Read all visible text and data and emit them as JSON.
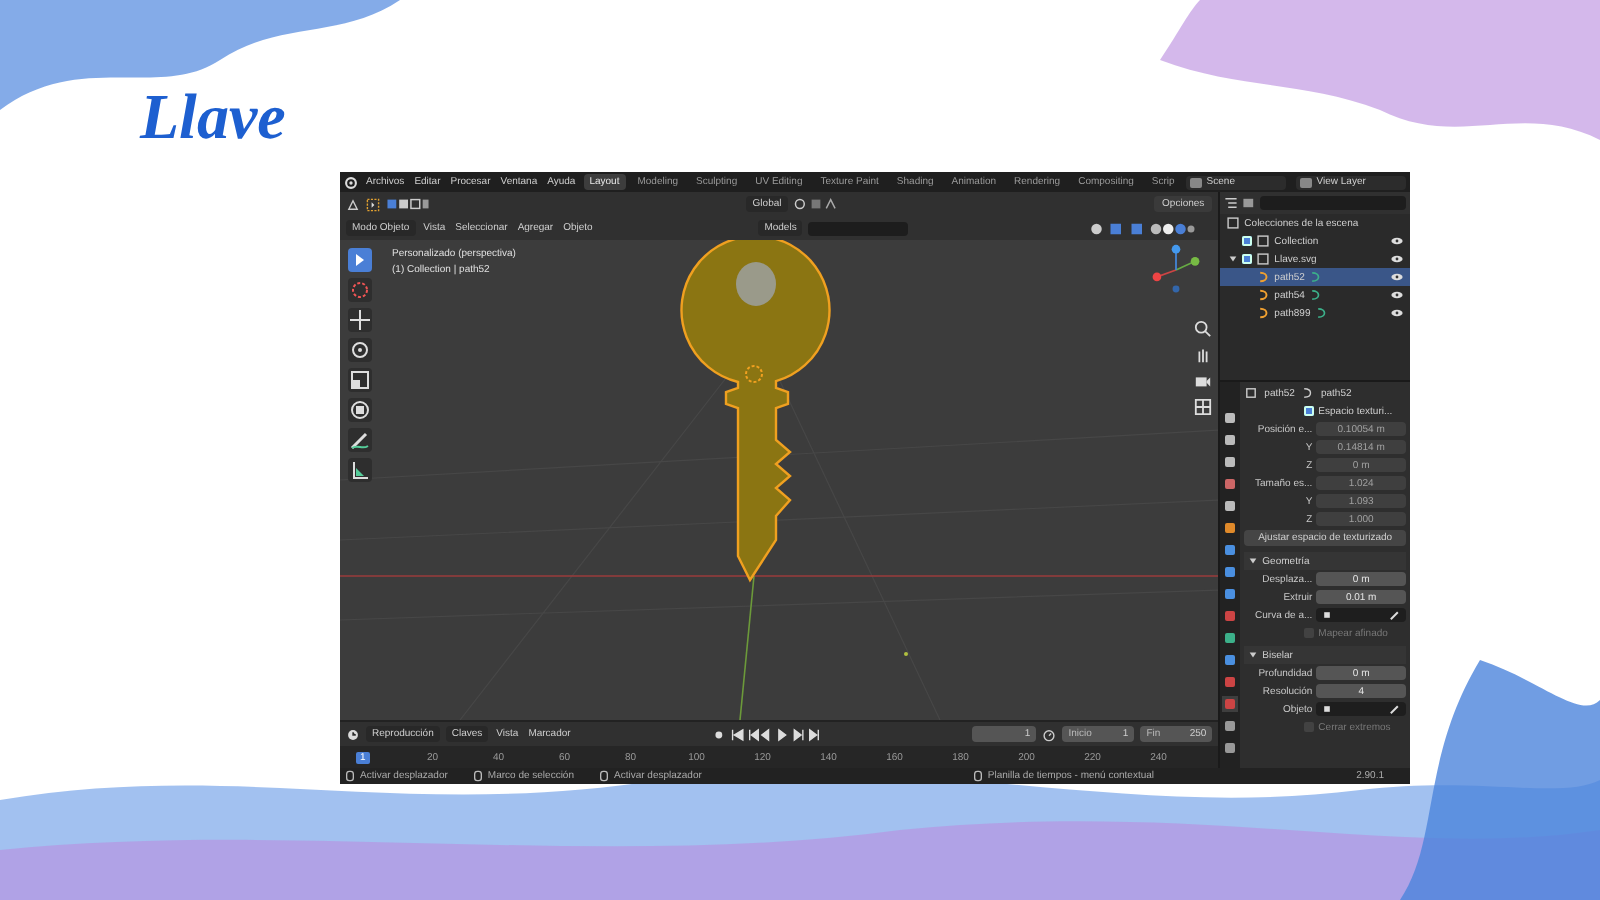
{
  "slide_title": "Llave",
  "menu": [
    "Archivos",
    "Editar",
    "Procesar",
    "Ventana",
    "Ayuda"
  ],
  "workspaces": [
    {
      "label": "Layout",
      "selected": true
    },
    {
      "label": "Modeling",
      "selected": false
    },
    {
      "label": "Sculpting",
      "selected": false
    },
    {
      "label": "UV Editing",
      "selected": false
    },
    {
      "label": "Texture Paint",
      "selected": false
    },
    {
      "label": "Shading",
      "selected": false
    },
    {
      "label": "Animation",
      "selected": false
    },
    {
      "label": "Rendering",
      "selected": false
    },
    {
      "label": "Compositing",
      "selected": false
    },
    {
      "label": "Scrip",
      "selected": false
    }
  ],
  "scene": "Scene",
  "view_layer": "View Layer",
  "viewport": {
    "orientation": "Global",
    "options": "Opciones",
    "mode": "Modo Objeto",
    "menus": [
      "Vista",
      "Seleccionar",
      "Agregar",
      "Objeto"
    ],
    "collection_filter": "Models",
    "view_name": "Personalizado (perspectiva)",
    "collection_path": "(1) Collection | path52"
  },
  "outliner": {
    "root": "Colecciones de la escena",
    "items": [
      {
        "label": "Collection",
        "checked": true
      },
      {
        "label": "Llave.svg",
        "checked": true,
        "children": [
          {
            "label": "path52",
            "selected": true
          },
          {
            "label": "path54",
            "selected": false
          },
          {
            "label": "path899",
            "selected": false
          }
        ]
      }
    ]
  },
  "properties": {
    "object": "path52",
    "data": "path52",
    "texture_space": {
      "label": "Espacio texturi...",
      "checked": true
    },
    "texture_fields": [
      {
        "label": "Posición e...",
        "value": "0.10054 m",
        "disabled": true
      },
      {
        "label": "Y",
        "value": "0.14814 m",
        "disabled": true
      },
      {
        "label": "Z",
        "value": "0 m",
        "disabled": true
      },
      {
        "label": "Tamaño es...",
        "value": "1.024",
        "disabled": true
      },
      {
        "label": "Y",
        "value": "1.093",
        "disabled": true
      },
      {
        "label": "Z",
        "value": "1.000",
        "disabled": true
      }
    ],
    "fit_button": "Ajustar espacio de texturizado",
    "panels": [
      {
        "title": "Geometría",
        "expanded": true,
        "rows": [
          {
            "kind": "number",
            "label": "Desplaza...",
            "value": "0 m"
          },
          {
            "kind": "number",
            "label": "Extruir",
            "value": "0.01 m"
          },
          {
            "kind": "object",
            "label": "Curva de a..."
          },
          {
            "kind": "checkbox",
            "label": "Mapear afinado",
            "checked": false,
            "disabled": true
          }
        ]
      },
      {
        "title": "Biselar",
        "expanded": true,
        "rows": [
          {
            "kind": "number",
            "label": "Profundidad",
            "value": "0 m"
          },
          {
            "kind": "number",
            "label": "Resolución",
            "value": "4"
          },
          {
            "kind": "object",
            "label": "Objeto"
          },
          {
            "kind": "checkbox",
            "label": "Cerrar extremos",
            "checked": false,
            "disabled": true
          }
        ]
      }
    ]
  },
  "timeline": {
    "menus": [
      {
        "label": "Reproducción",
        "dropdown": true
      },
      {
        "label": "Claves",
        "dropdown": true
      },
      {
        "label": "Vista",
        "dropdown": false
      },
      {
        "label": "Marcador",
        "dropdown": false
      }
    ],
    "current_frame": "1",
    "start_label": "Inicio",
    "start": "1",
    "end_label": "Fin",
    "end": "250",
    "playhead": "1",
    "ruler": [
      "20",
      "40",
      "60",
      "80",
      "100",
      "120",
      "140",
      "160",
      "180",
      "200",
      "220",
      "240"
    ]
  },
  "status_bar": {
    "hints": [
      "Activar desplazador",
      "Marco de selección",
      "Activar desplazador",
      "Planilla de tiempos - menú contextual"
    ],
    "version": "2.90.1"
  }
}
